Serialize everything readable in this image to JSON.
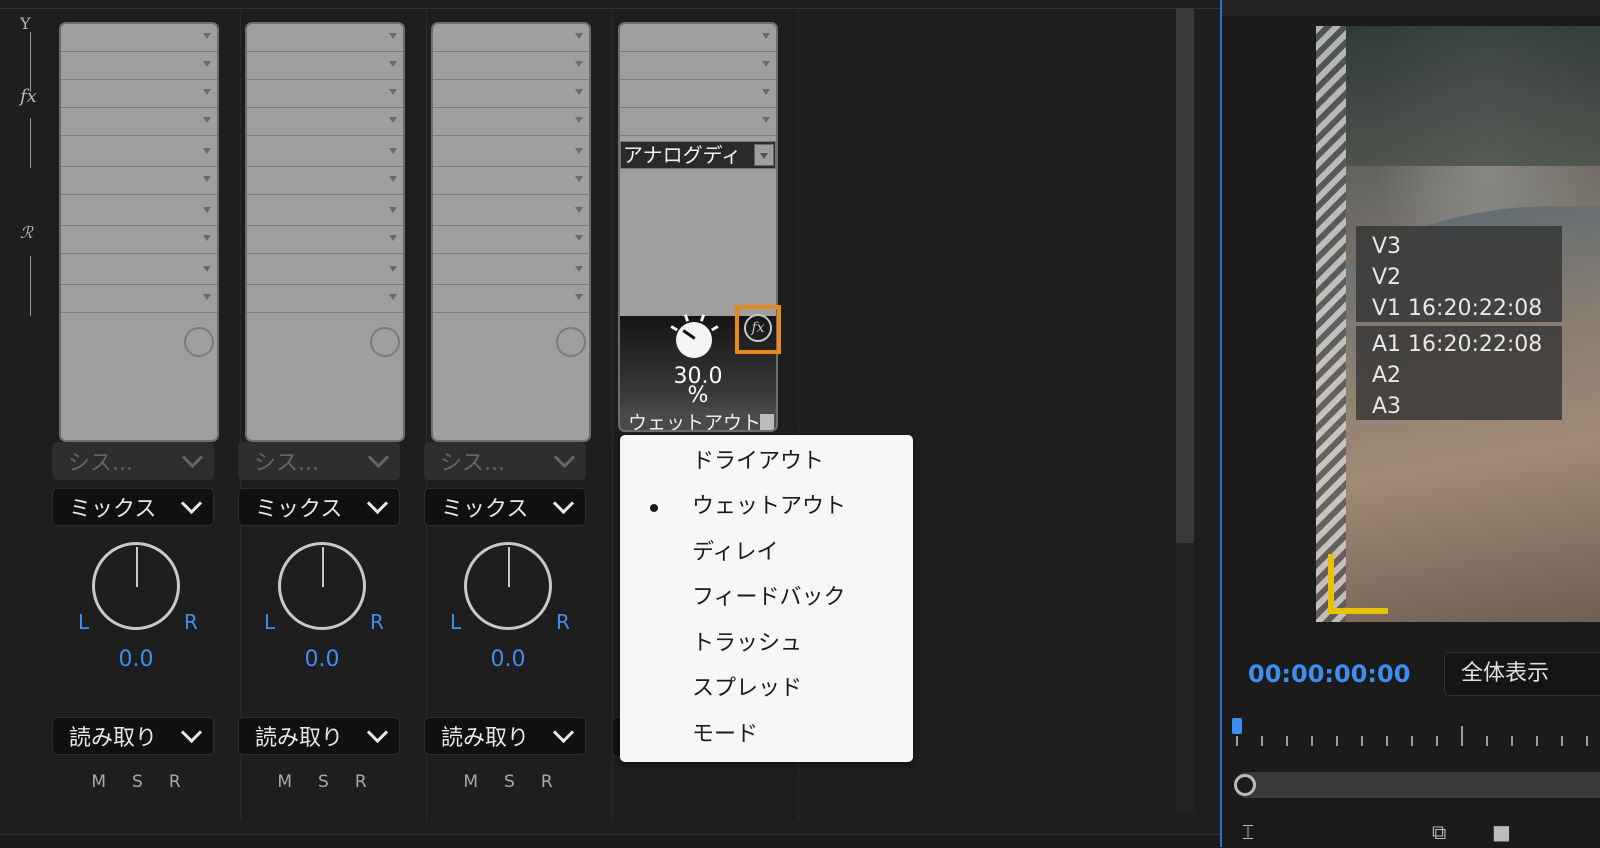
{
  "mixer": {
    "left_rail": {
      "fx_glyph": "fx",
      "send_glyph": "ℛ"
    },
    "strips": [
      {
        "input_label": "シス...",
        "output_label": "ミックス",
        "pan_l": "L",
        "pan_r": "R",
        "pan_value": "0.0",
        "automation_label": "読み取り",
        "m": "M",
        "s": "S",
        "r": "R"
      },
      {
        "input_label": "シス...",
        "output_label": "ミックス",
        "pan_l": "L",
        "pan_r": "R",
        "pan_value": "0.0",
        "automation_label": "読み取り",
        "m": "M",
        "s": "S",
        "r": "R"
      },
      {
        "input_label": "シス...",
        "output_label": "ミックス",
        "pan_l": "L",
        "pan_r": "R",
        "pan_value": "0.0",
        "automation_label": "読み取り",
        "m": "M",
        "s": "S",
        "r": "R"
      }
    ],
    "strip4": {
      "effect_slot_label": "アナログディ",
      "param_value": "30.0",
      "param_unit": "%",
      "param_selector": "ウェットアウト",
      "fx_button_glyph": "fx",
      "fx_highlight_color": "#e88a1a"
    }
  },
  "popup_menu": {
    "items": [
      {
        "label": "ドライアウト",
        "selected": false
      },
      {
        "label": "ウェットアウト",
        "selected": true
      },
      {
        "label": "ディレイ",
        "selected": false
      },
      {
        "label": "フィードバック",
        "selected": false
      },
      {
        "label": "トラッシュ",
        "selected": false
      },
      {
        "label": "スプレッド",
        "selected": false
      },
      {
        "label": "モード",
        "selected": false
      }
    ]
  },
  "monitor": {
    "overlay_video": [
      "V3",
      "V2",
      "V1 16:20:22:08"
    ],
    "overlay_audio": [
      "A1 16:20:22:08",
      "A2",
      "A3"
    ],
    "timecode": "00:00:00:00",
    "fit_label": "全体表示",
    "accent_color": "#3d8ef0",
    "safe_corner_color": "#e6c200"
  }
}
